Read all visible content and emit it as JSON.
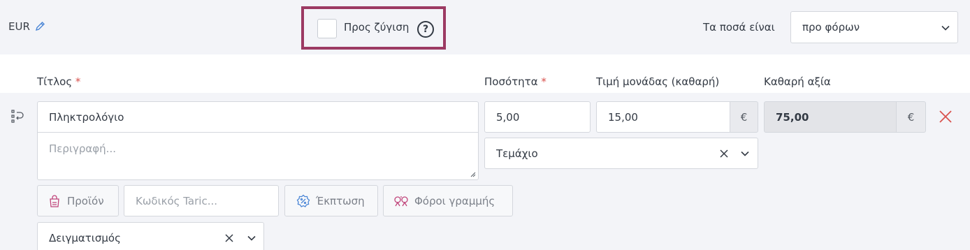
{
  "header": {
    "currency": "EUR",
    "weigh_label": "Προς ζύγιση",
    "help_symbol": "?",
    "amounts_label": "Τα ποσά είναι",
    "amounts_value": "προ φόρων"
  },
  "columns": {
    "title": "Τίτλος",
    "quantity": "Ποσότητα",
    "unit_price": "Τιμή μονάδας (καθαρή)",
    "net_value": "Καθαρή αξία",
    "required_mark": "*"
  },
  "line": {
    "title_value": "Πληκτρολόγιο",
    "description_placeholder": "Περιγραφή...",
    "quantity": "5,00",
    "unit_price": "15,00",
    "currency_symbol": "€",
    "net_value": "75,00",
    "unit": "Τεμάχιο",
    "product_button": "Προϊόν",
    "taric_placeholder": "Κωδικός Taric...",
    "discount_button": "Έκπτωση",
    "line_taxes_button": "Φόροι γραμμής",
    "sampling": "Δειγματισμός"
  },
  "colors": {
    "accent": "#4b86d6",
    "highlight_border": "#9c3a63",
    "delete": "#d9534f",
    "product_icon": "#c0447a"
  }
}
